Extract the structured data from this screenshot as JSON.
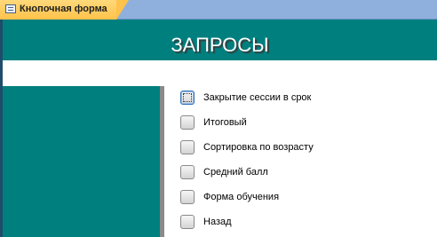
{
  "tab": {
    "label": "Кнопочная форма",
    "icon": "form-icon"
  },
  "header": {
    "title": "ЗАПРОСЫ"
  },
  "menu": {
    "items": [
      {
        "label": "Закрытие сессии в срок",
        "focused": true
      },
      {
        "label": "Итоговый",
        "focused": false
      },
      {
        "label": "Сортировка по возрасту",
        "focused": false
      },
      {
        "label": "Средний балл",
        "focused": false
      },
      {
        "label": "Форма обучения",
        "focused": false
      },
      {
        "label": "Назад",
        "focused": false
      }
    ]
  },
  "colors": {
    "banner": "#007f7f",
    "tab": "#ffc24a",
    "tabbar": "#8fb0dc",
    "divider": "#8a8a8a"
  }
}
